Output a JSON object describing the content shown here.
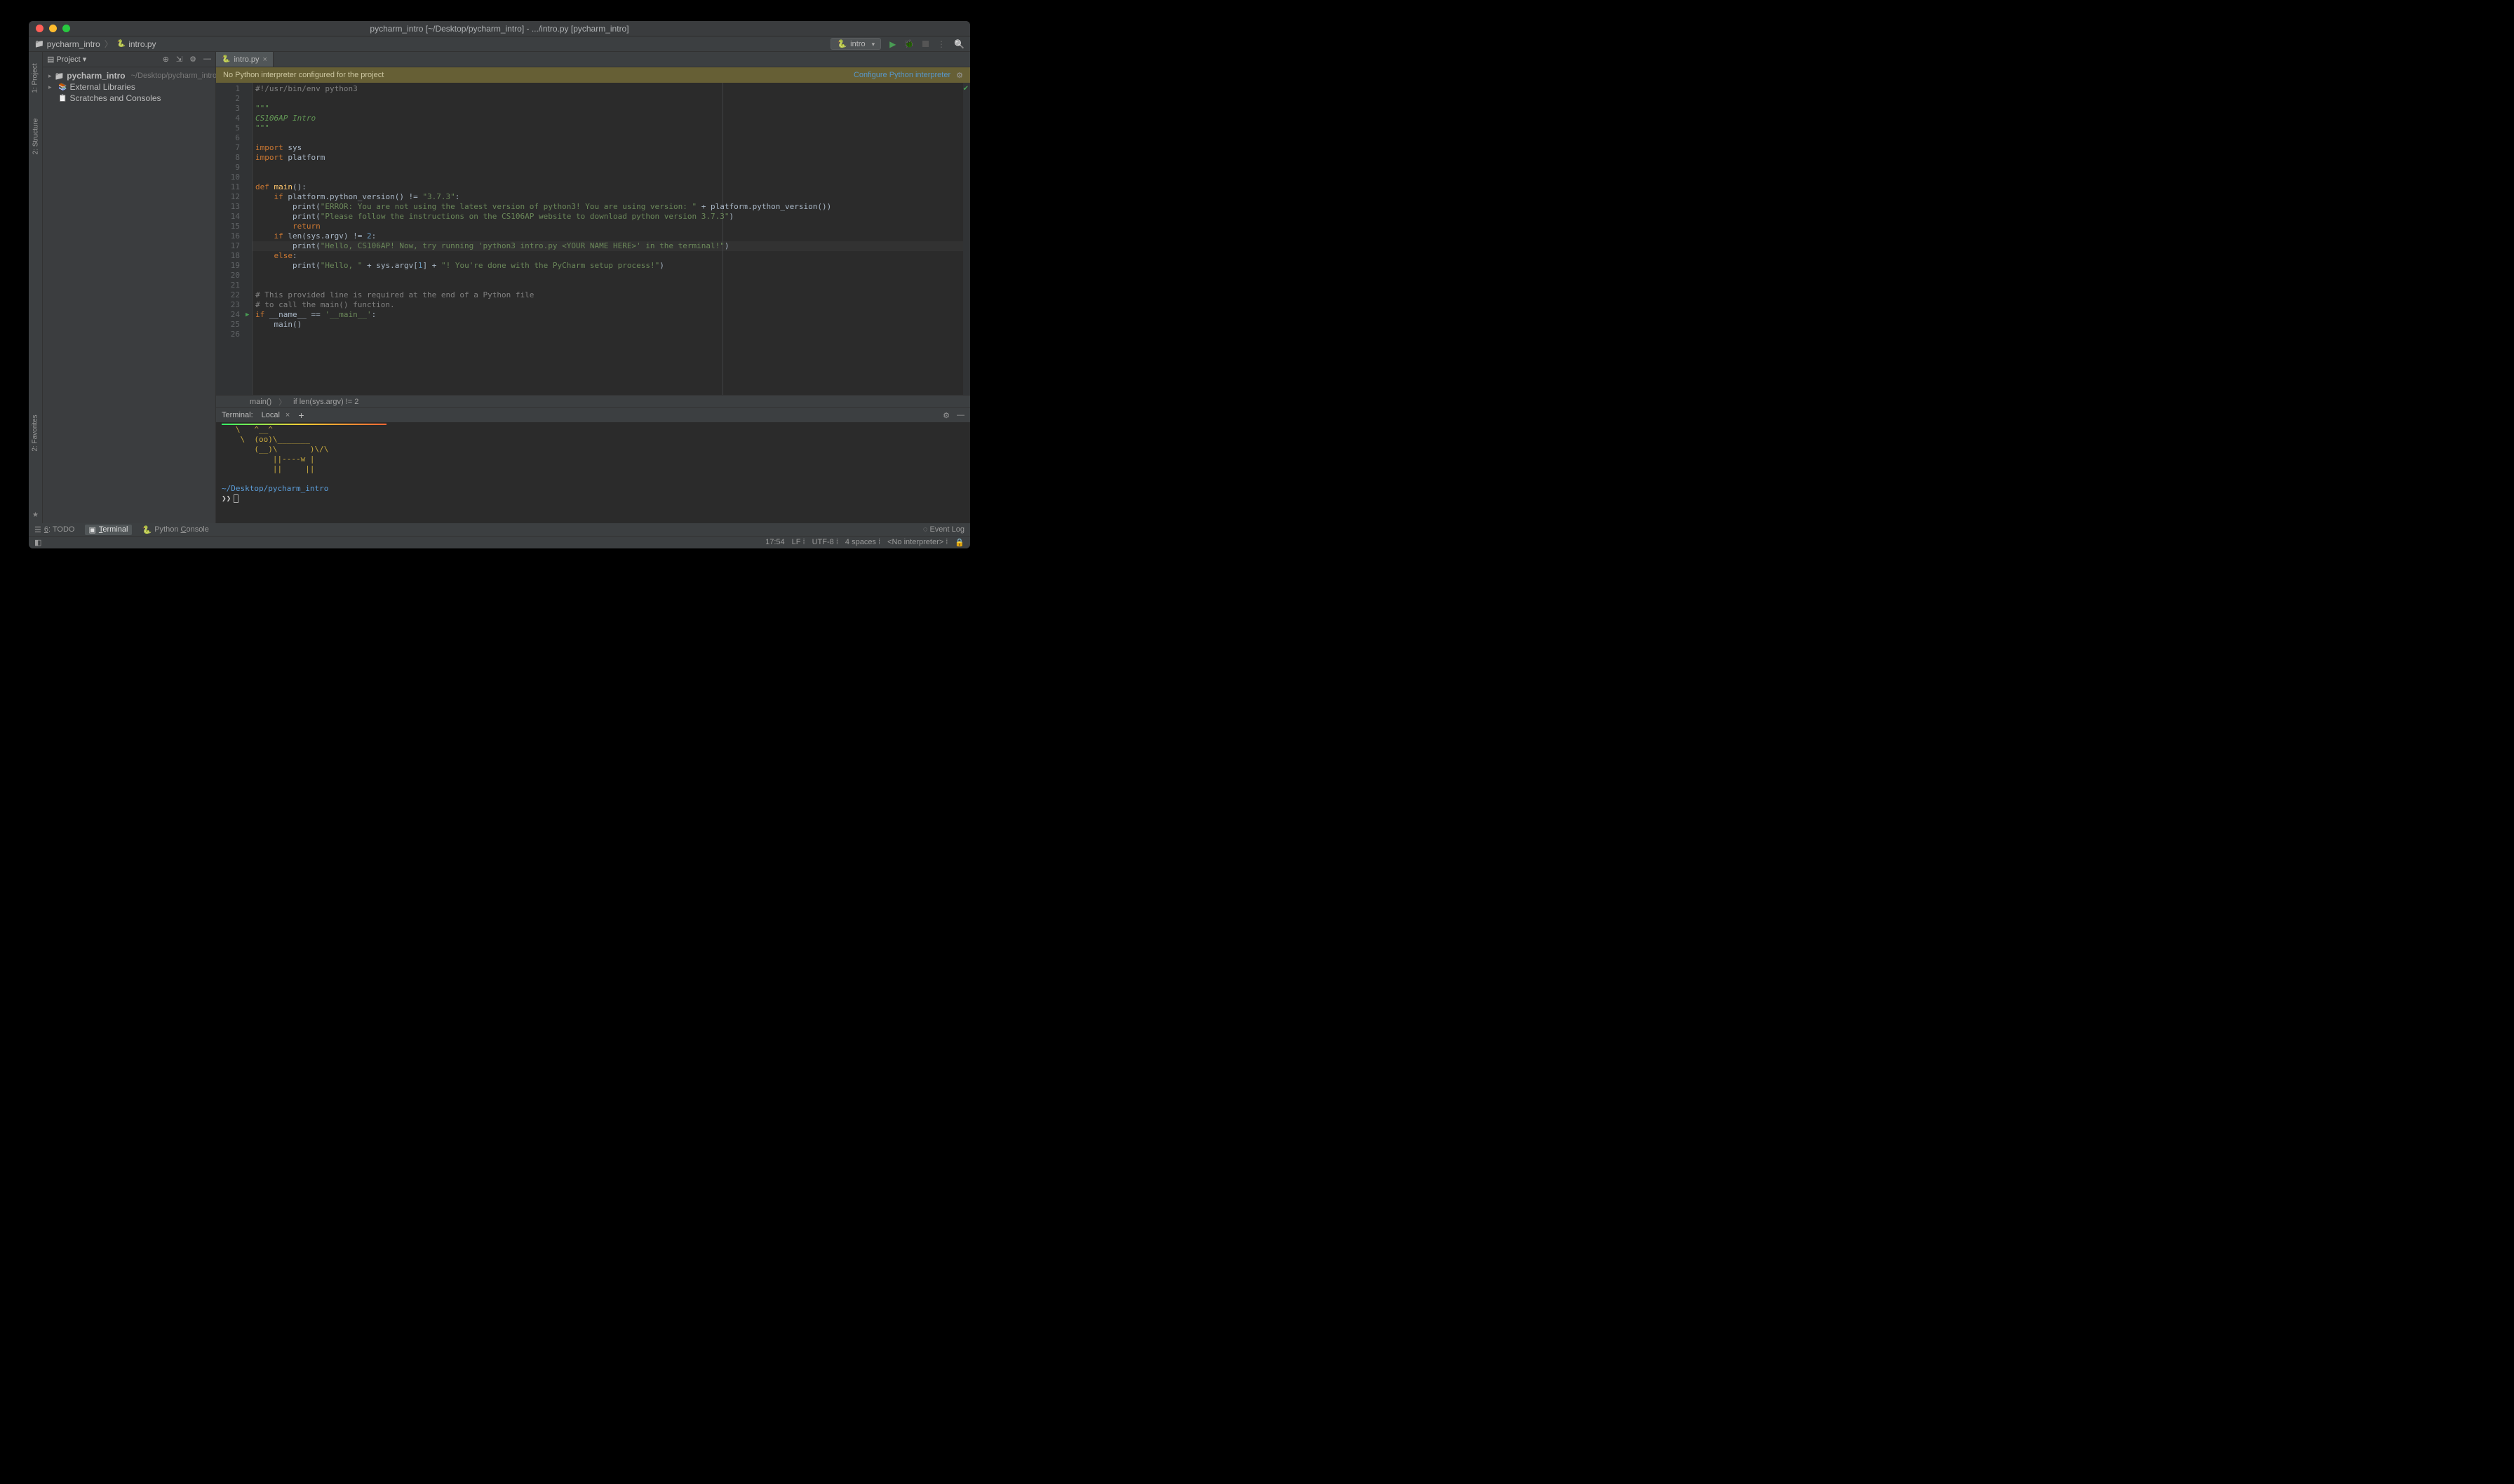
{
  "title": "pycharm_intro [~/Desktop/pycharm_intro] - .../intro.py [pycharm_intro]",
  "breadcrumb": {
    "project": "pycharm_intro",
    "file": "intro.py"
  },
  "run_config": "intro",
  "sidebar": {
    "header": "Project",
    "items": [
      {
        "name": "pycharm_intro",
        "path": "~/Desktop/pycharm_intro",
        "icon": "folder",
        "expandable": true
      },
      {
        "name": "External Libraries",
        "icon": "lib",
        "expandable": true
      },
      {
        "name": "Scratches and Consoles",
        "icon": "scratch",
        "expandable": false
      }
    ]
  },
  "left_tabs": [
    "1: Project",
    "2: Structure",
    "2: Favorites"
  ],
  "editor": {
    "tab": "intro.py",
    "banner_msg": "No Python interpreter configured for the project",
    "banner_link": "Configure Python interpreter",
    "ruler_col": 670,
    "highlighted_line": 17,
    "run_icon_line": 24,
    "lines": [
      {
        "n": 1,
        "tokens": [
          {
            "t": "#!/usr/bin/env python3",
            "c": "com"
          }
        ]
      },
      {
        "n": 2,
        "tokens": []
      },
      {
        "n": 3,
        "tokens": [
          {
            "t": "\"\"\"",
            "c": "doc"
          }
        ]
      },
      {
        "n": 4,
        "tokens": [
          {
            "t": "CS106AP Intro",
            "c": "doc"
          }
        ]
      },
      {
        "n": 5,
        "tokens": [
          {
            "t": "\"\"\"",
            "c": "doc"
          }
        ]
      },
      {
        "n": 6,
        "tokens": []
      },
      {
        "n": 7,
        "tokens": [
          {
            "t": "import ",
            "c": "kw"
          },
          {
            "t": "sys"
          }
        ]
      },
      {
        "n": 8,
        "tokens": [
          {
            "t": "import ",
            "c": "kw"
          },
          {
            "t": "platform"
          }
        ]
      },
      {
        "n": 9,
        "tokens": []
      },
      {
        "n": 10,
        "tokens": []
      },
      {
        "n": 11,
        "tokens": [
          {
            "t": "def ",
            "c": "kw"
          },
          {
            "t": "main",
            "c": "fn"
          },
          {
            "t": "():"
          }
        ]
      },
      {
        "n": 12,
        "tokens": [
          {
            "t": "    "
          },
          {
            "t": "if ",
            "c": "kw"
          },
          {
            "t": "platform.python_version() != "
          },
          {
            "t": "\"3.7.3\"",
            "c": "str"
          },
          {
            "t": ":"
          }
        ]
      },
      {
        "n": 13,
        "tokens": [
          {
            "t": "        "
          },
          {
            "t": "print("
          },
          {
            "t": "\"ERROR: You are not using the latest version of python3! You are using version: \"",
            "c": "str"
          },
          {
            "t": " + platform.python_version())"
          }
        ]
      },
      {
        "n": 14,
        "tokens": [
          {
            "t": "        "
          },
          {
            "t": "print("
          },
          {
            "t": "\"Please follow the instructions on the CS106AP website to download python version 3.7.3\"",
            "c": "str"
          },
          {
            "t": ")"
          }
        ]
      },
      {
        "n": 15,
        "tokens": [
          {
            "t": "        "
          },
          {
            "t": "return",
            "c": "kw"
          }
        ]
      },
      {
        "n": 16,
        "tokens": [
          {
            "t": "    "
          },
          {
            "t": "if ",
            "c": "kw"
          },
          {
            "t": "len(sys.argv) != "
          },
          {
            "t": "2",
            "c": "num"
          },
          {
            "t": ":"
          }
        ]
      },
      {
        "n": 17,
        "tokens": [
          {
            "t": "        "
          },
          {
            "t": "print("
          },
          {
            "t": "\"Hello, CS106AP! Now, try running 'python3 intro.py <YOUR NAME HERE>' in the terminal!\"",
            "c": "str"
          },
          {
            "t": ")"
          }
        ]
      },
      {
        "n": 18,
        "tokens": [
          {
            "t": "    "
          },
          {
            "t": "else",
            "c": "kw"
          },
          {
            "t": ":"
          }
        ]
      },
      {
        "n": 19,
        "tokens": [
          {
            "t": "        "
          },
          {
            "t": "print("
          },
          {
            "t": "\"Hello, \"",
            "c": "str"
          },
          {
            "t": " + sys.argv["
          },
          {
            "t": "1",
            "c": "num"
          },
          {
            "t": "] + "
          },
          {
            "t": "\"! You're done with the PyCharm setup process!\"",
            "c": "str"
          },
          {
            "t": ")"
          }
        ]
      },
      {
        "n": 20,
        "tokens": []
      },
      {
        "n": 21,
        "tokens": []
      },
      {
        "n": 22,
        "tokens": [
          {
            "t": "# This provided line is required at the end of a Python file",
            "c": "com"
          }
        ]
      },
      {
        "n": 23,
        "tokens": [
          {
            "t": "# to call the main() function.",
            "c": "com"
          }
        ]
      },
      {
        "n": 24,
        "tokens": [
          {
            "t": "if ",
            "c": "kw"
          },
          {
            "t": "__name__ == "
          },
          {
            "t": "'__main__'",
            "c": "str"
          },
          {
            "t": ":"
          }
        ]
      },
      {
        "n": 25,
        "tokens": [
          {
            "t": "    main()"
          }
        ]
      },
      {
        "n": 26,
        "tokens": []
      }
    ],
    "crumb": [
      "main()",
      "if len(sys.argv) != 2"
    ]
  },
  "terminal": {
    "header": "Terminal:",
    "tab": "Local",
    "art": "   \\   ^__^\n    \\  (oo)\\_______\n       (__)\\       )\\/\\\n           ||----w |\n           ||     ||",
    "cwd": "~/Desktop/pycharm_intro",
    "prompt": "❯❯"
  },
  "bottom_tabs": [
    {
      "label": "6: TODO",
      "key": "6",
      "active": false,
      "underline_idx": 3
    },
    {
      "label": "Terminal",
      "active": true,
      "underline_idx": 0
    },
    {
      "label": "Python Console",
      "active": false,
      "underline_idx": 9
    }
  ],
  "event_log": "Event Log",
  "status": {
    "pos": "17:54",
    "sep": "LF",
    "enc": "UTF-8",
    "indent": "4 spaces",
    "interp": "<No interpreter>"
  }
}
